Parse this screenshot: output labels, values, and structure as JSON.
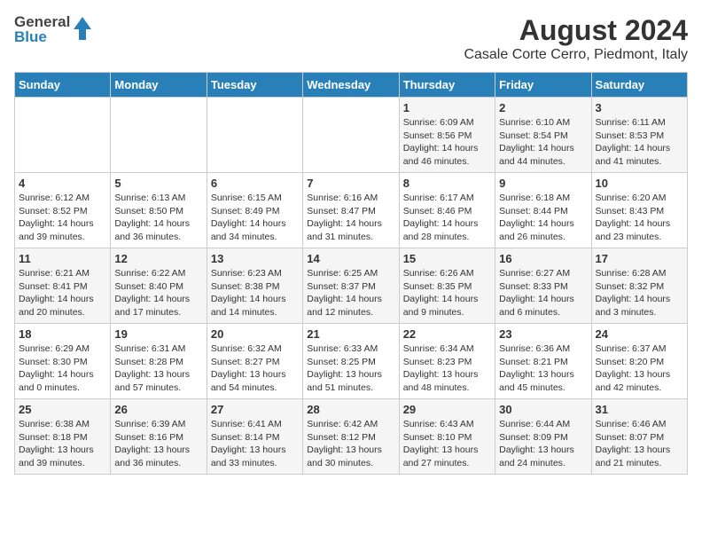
{
  "logo": {
    "general": "General",
    "blue": "Blue"
  },
  "header": {
    "month": "August 2024",
    "location": "Casale Corte Cerro, Piedmont, Italy"
  },
  "weekdays": [
    "Sunday",
    "Monday",
    "Tuesday",
    "Wednesday",
    "Thursday",
    "Friday",
    "Saturday"
  ],
  "weeks": [
    [
      {
        "day": "",
        "info": ""
      },
      {
        "day": "",
        "info": ""
      },
      {
        "day": "",
        "info": ""
      },
      {
        "day": "",
        "info": ""
      },
      {
        "day": "1",
        "info": "Sunrise: 6:09 AM\nSunset: 8:56 PM\nDaylight: 14 hours\nand 46 minutes."
      },
      {
        "day": "2",
        "info": "Sunrise: 6:10 AM\nSunset: 8:54 PM\nDaylight: 14 hours\nand 44 minutes."
      },
      {
        "day": "3",
        "info": "Sunrise: 6:11 AM\nSunset: 8:53 PM\nDaylight: 14 hours\nand 41 minutes."
      }
    ],
    [
      {
        "day": "4",
        "info": "Sunrise: 6:12 AM\nSunset: 8:52 PM\nDaylight: 14 hours\nand 39 minutes."
      },
      {
        "day": "5",
        "info": "Sunrise: 6:13 AM\nSunset: 8:50 PM\nDaylight: 14 hours\nand 36 minutes."
      },
      {
        "day": "6",
        "info": "Sunrise: 6:15 AM\nSunset: 8:49 PM\nDaylight: 14 hours\nand 34 minutes."
      },
      {
        "day": "7",
        "info": "Sunrise: 6:16 AM\nSunset: 8:47 PM\nDaylight: 14 hours\nand 31 minutes."
      },
      {
        "day": "8",
        "info": "Sunrise: 6:17 AM\nSunset: 8:46 PM\nDaylight: 14 hours\nand 28 minutes."
      },
      {
        "day": "9",
        "info": "Sunrise: 6:18 AM\nSunset: 8:44 PM\nDaylight: 14 hours\nand 26 minutes."
      },
      {
        "day": "10",
        "info": "Sunrise: 6:20 AM\nSunset: 8:43 PM\nDaylight: 14 hours\nand 23 minutes."
      }
    ],
    [
      {
        "day": "11",
        "info": "Sunrise: 6:21 AM\nSunset: 8:41 PM\nDaylight: 14 hours\nand 20 minutes."
      },
      {
        "day": "12",
        "info": "Sunrise: 6:22 AM\nSunset: 8:40 PM\nDaylight: 14 hours\nand 17 minutes."
      },
      {
        "day": "13",
        "info": "Sunrise: 6:23 AM\nSunset: 8:38 PM\nDaylight: 14 hours\nand 14 minutes."
      },
      {
        "day": "14",
        "info": "Sunrise: 6:25 AM\nSunset: 8:37 PM\nDaylight: 14 hours\nand 12 minutes."
      },
      {
        "day": "15",
        "info": "Sunrise: 6:26 AM\nSunset: 8:35 PM\nDaylight: 14 hours\nand 9 minutes."
      },
      {
        "day": "16",
        "info": "Sunrise: 6:27 AM\nSunset: 8:33 PM\nDaylight: 14 hours\nand 6 minutes."
      },
      {
        "day": "17",
        "info": "Sunrise: 6:28 AM\nSunset: 8:32 PM\nDaylight: 14 hours\nand 3 minutes."
      }
    ],
    [
      {
        "day": "18",
        "info": "Sunrise: 6:29 AM\nSunset: 8:30 PM\nDaylight: 14 hours\nand 0 minutes."
      },
      {
        "day": "19",
        "info": "Sunrise: 6:31 AM\nSunset: 8:28 PM\nDaylight: 13 hours\nand 57 minutes."
      },
      {
        "day": "20",
        "info": "Sunrise: 6:32 AM\nSunset: 8:27 PM\nDaylight: 13 hours\nand 54 minutes."
      },
      {
        "day": "21",
        "info": "Sunrise: 6:33 AM\nSunset: 8:25 PM\nDaylight: 13 hours\nand 51 minutes."
      },
      {
        "day": "22",
        "info": "Sunrise: 6:34 AM\nSunset: 8:23 PM\nDaylight: 13 hours\nand 48 minutes."
      },
      {
        "day": "23",
        "info": "Sunrise: 6:36 AM\nSunset: 8:21 PM\nDaylight: 13 hours\nand 45 minutes."
      },
      {
        "day": "24",
        "info": "Sunrise: 6:37 AM\nSunset: 8:20 PM\nDaylight: 13 hours\nand 42 minutes."
      }
    ],
    [
      {
        "day": "25",
        "info": "Sunrise: 6:38 AM\nSunset: 8:18 PM\nDaylight: 13 hours\nand 39 minutes."
      },
      {
        "day": "26",
        "info": "Sunrise: 6:39 AM\nSunset: 8:16 PM\nDaylight: 13 hours\nand 36 minutes."
      },
      {
        "day": "27",
        "info": "Sunrise: 6:41 AM\nSunset: 8:14 PM\nDaylight: 13 hours\nand 33 minutes."
      },
      {
        "day": "28",
        "info": "Sunrise: 6:42 AM\nSunset: 8:12 PM\nDaylight: 13 hours\nand 30 minutes."
      },
      {
        "day": "29",
        "info": "Sunrise: 6:43 AM\nSunset: 8:10 PM\nDaylight: 13 hours\nand 27 minutes."
      },
      {
        "day": "30",
        "info": "Sunrise: 6:44 AM\nSunset: 8:09 PM\nDaylight: 13 hours\nand 24 minutes."
      },
      {
        "day": "31",
        "info": "Sunrise: 6:46 AM\nSunset: 8:07 PM\nDaylight: 13 hours\nand 21 minutes."
      }
    ]
  ]
}
